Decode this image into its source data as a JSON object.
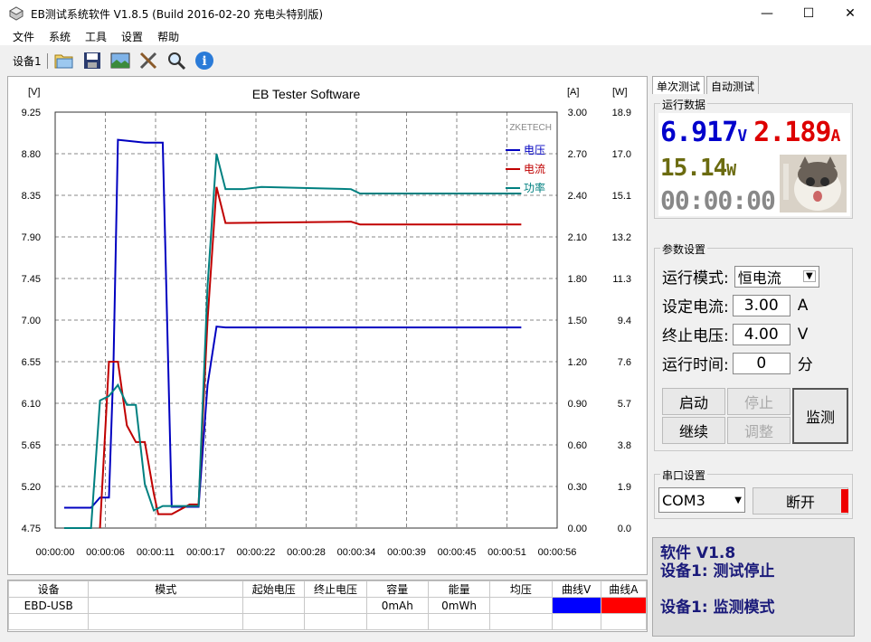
{
  "window": {
    "title": "EB测试系统软件 V1.8.5 (Build 2016-02-20 充电头特别版)",
    "minimize": "—",
    "maximize": "☐",
    "close": "✕"
  },
  "menu": [
    "文件",
    "系统",
    "工具",
    "设置",
    "帮助"
  ],
  "toolbar": {
    "device_label": "设备1",
    "icons": [
      "open-folder-icon",
      "save-icon",
      "image-icon",
      "tools-icon",
      "search-icon",
      "info-icon"
    ]
  },
  "chart_data": {
    "type": "line",
    "title": "EB Tester Software",
    "watermark": "ZKETECH",
    "left_unit": "[V]",
    "right_unit_a": "[A]",
    "right_unit_w": "[W]",
    "yticks_left": [
      "9.25",
      "8.80",
      "8.35",
      "7.90",
      "7.45",
      "7.00",
      "6.55",
      "6.10",
      "5.65",
      "5.20",
      "4.75"
    ],
    "yticks_a": [
      "3.00",
      "2.70",
      "2.40",
      "2.10",
      "1.80",
      "1.50",
      "1.20",
      "0.90",
      "0.60",
      "0.30",
      "0.00"
    ],
    "yticks_w": [
      "18.9",
      "17.0",
      "15.1",
      "13.2",
      "11.3",
      "9.4",
      "7.6",
      "5.7",
      "3.8",
      "1.9",
      "0.0"
    ],
    "xticks": [
      "00:00:00",
      "00:00:06",
      "00:00:11",
      "00:00:17",
      "00:00:22",
      "00:00:28",
      "00:00:34",
      "00:00:39",
      "00:00:45",
      "00:00:51",
      "00:00:56"
    ],
    "ylim_v": [
      4.75,
      9.25
    ],
    "ylim_a": [
      0,
      3.0
    ],
    "ylim_w": [
      0,
      18.9
    ],
    "xlim": [
      0,
      56
    ],
    "legend_position": "top-right",
    "grid": true,
    "series": [
      {
        "name": "电压",
        "color": "#0000c0",
        "x": [
          1,
          4,
          5,
          6,
          6.5,
          7,
          10,
          12,
          13,
          16,
          17,
          18,
          19,
          52
        ],
        "y": [
          4.97,
          4.97,
          5.08,
          5.08,
          6.5,
          8.95,
          8.92,
          8.92,
          4.98,
          4.98,
          6.3,
          6.93,
          6.92,
          6.92
        ]
      },
      {
        "name": "电流",
        "color": "#c00000",
        "x": [
          5,
          6,
          7,
          8,
          9,
          10,
          11,
          11.5,
          13,
          15,
          16,
          17,
          18,
          19,
          33,
          34,
          52
        ],
        "y": [
          0.0,
          1.2,
          1.2,
          0.74,
          0.62,
          0.62,
          0.25,
          0.1,
          0.1,
          0.17,
          0.17,
          1.5,
          2.46,
          2.2,
          2.21,
          2.19,
          2.19
        ]
      },
      {
        "name": "功率",
        "color": "#008080",
        "x": [
          1,
          4,
          5,
          6,
          7,
          8,
          9,
          10,
          11,
          12,
          16,
          17,
          18,
          19,
          20,
          21,
          23,
          33,
          34,
          52
        ],
        "y": [
          0.0,
          0.0,
          5.8,
          6.0,
          6.5,
          5.6,
          5.6,
          2.0,
          0.8,
          1.0,
          1.0,
          11.0,
          17.0,
          15.4,
          15.4,
          15.4,
          15.5,
          15.4,
          15.2,
          15.2
        ]
      }
    ]
  },
  "table": {
    "headers": [
      "设备",
      "模式",
      "起始电压",
      "终止电压",
      "容量",
      "能量",
      "均压",
      "曲线V",
      "曲线A"
    ],
    "row": [
      "EBD-USB",
      "",
      "",
      "",
      "0mAh",
      "0mWh",
      "",
      "",
      ""
    ],
    "curve_v_color": "#0000ff",
    "curve_a_color": "#ff0000"
  },
  "right": {
    "tabs": [
      "单次测试",
      "自动测试"
    ],
    "run_data_label": "运行数据",
    "voltage": "6.917",
    "voltage_unit": "V",
    "current": "2.189",
    "current_unit": "A",
    "power": "15.14",
    "power_unit": "W",
    "time": "00:00:00",
    "params_label": "参数设置",
    "mode_label": "运行模式:",
    "mode_value": "恒电流",
    "current_label": "设定电流:",
    "current_value": "3.00",
    "current_value_unit": "A",
    "stop_v_label": "终止电压:",
    "stop_v_value": "4.00",
    "stop_v_unit": "V",
    "time_label": "运行时间:",
    "time_value": "0",
    "time_unit": "分",
    "start_btn": "启动",
    "stop_btn": "停止",
    "continue_btn": "继续",
    "adjust_btn": "调整",
    "monitor_btn": "监测",
    "serial_label": "串口设置",
    "com_port": "COM3",
    "disconnect_btn": "断开",
    "status_version": "软件 V1.8",
    "status_line1": "设备1: 测试停止",
    "status_line2": "设备1: 监测模式"
  }
}
